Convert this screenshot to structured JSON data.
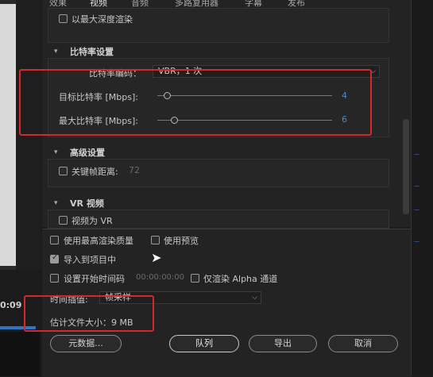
{
  "tabs": [
    "效果",
    "视频",
    "音频",
    "多路复用器",
    "字幕",
    "发布"
  ],
  "render_max_depth": "以最大深度渲染",
  "bitrate": {
    "section_title": "比特率设置",
    "encoding_label": "比特率编码：",
    "encoding_value": "VBR，1 次",
    "target_label": "目标比特率 [Mbps]:",
    "target_value": "4",
    "max_label": "最大比特率 [Mbps]:",
    "max_value": "6",
    "target_fraction": 0.04,
    "max_fraction": 0.08
  },
  "advanced": {
    "section_title": "高级设置",
    "keyframe_label": "关键帧距离:",
    "keyframe_value": "72"
  },
  "vr": {
    "section_title": "VR 视频",
    "video_is_vr": "视频为 VR"
  },
  "options": {
    "max_render_quality": "使用最高渲染质量",
    "use_previews": "使用预览",
    "import_into_project": "导入到项目中",
    "set_start_timecode": "设置开始时间码",
    "start_timecode_value": "00:00:00:00",
    "render_alpha_only": "仅渲染 Alpha 通道"
  },
  "interpolation": {
    "label": "时间插值:",
    "value": "帧采样"
  },
  "estimated_size": "估计文件大小：9 MB",
  "buttons": {
    "metadata": "元数据...",
    "queue": "队列",
    "export": "导出",
    "cancel": "取消"
  },
  "timecode": "0:09"
}
